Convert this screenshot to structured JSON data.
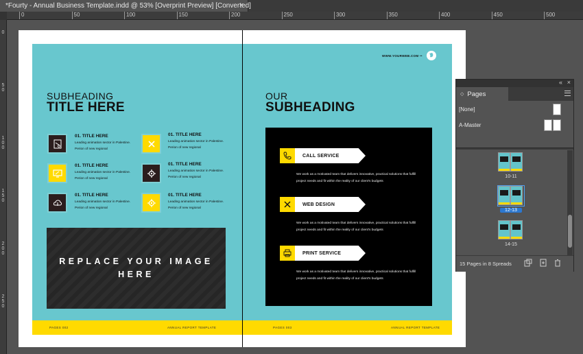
{
  "document_tab": {
    "title": "*Fourty - Annual Business Template.indd @ 53% [Overprint Preview] [Converted]",
    "close": "×"
  },
  "ruler_h": [
    "0",
    "50",
    "100",
    "150",
    "200",
    "250",
    "300",
    "350",
    "400",
    "450",
    "500"
  ],
  "ruler_v": [
    {
      "t": "0"
    },
    {
      "t": "5 0"
    },
    {
      "t": "1 0 0"
    },
    {
      "t": "1 5 0"
    },
    {
      "t": "2 0 0"
    },
    {
      "t": "2 5 0"
    }
  ],
  "left_page": {
    "subheading": "SUBHEADING",
    "title": "TITLE HERE",
    "features": [
      {
        "title": "01. TITLE HERE",
        "text": "Leading animation sector in Palestine. Perion of new regional",
        "icon": "note-icon"
      },
      {
        "title": "01. TITLE HERE",
        "text": "Leading animation sector in Palestine. Perion of new regional",
        "icon": "tools-icon"
      },
      {
        "title": "01. TITLE HERE",
        "text": "Leading animation sector in Palestine. Perion of new regional",
        "icon": "monitor-icon"
      },
      {
        "title": "01. TITLE HERE",
        "text": "Leading animation sector in Palestine. Perion of new regional",
        "icon": "gear-icon"
      },
      {
        "title": "01. TITLE HERE",
        "text": "Leading animation sector in Palestine. Perion of new regional",
        "icon": "cloud-icon"
      },
      {
        "title": "01. TITLE HERE",
        "text": "Leading animation sector in Palestine. Perion of new regional",
        "icon": "gear-icon"
      }
    ],
    "image_placeholder": "REPLACE YOUR IMAGE HERE",
    "footer_left": "PAGES 002",
    "footer_right": "ANNUAL REPORT TEMPLATE"
  },
  "right_page": {
    "web_url": "WWW.YOURWEB.COM ••",
    "subheading": "OUR",
    "title": "SUBHEADING",
    "services": [
      {
        "label": "CALL SERVICE",
        "text": "We work as a motivated team that delivers innovative, practical solutions that fulfill project needs and fit within the reality of our client's budgets",
        "icon": "phone-icon"
      },
      {
        "label": "WEB DESIGN",
        "text": "We work as a motivated team that delivers innovative, practical solutions that fulfill project needs and fit within the reality of our client's budgets",
        "icon": "tools-icon"
      },
      {
        "label": "PRINT SERVICE",
        "text": "We work as a motivated team that delivers innovative, practical solutions that fulfill project needs and fit within the reality of our client's budgets",
        "icon": "print-icon"
      }
    ],
    "footer_left": "PAGES 003",
    "footer_right": "ANNUAL REPORT TEMPLATE"
  },
  "pages_panel": {
    "tab_label": "Pages",
    "masters": [
      {
        "label": "[None]"
      },
      {
        "label": "A-Master"
      }
    ],
    "spreads": [
      {
        "label": "10-11",
        "selected": false
      },
      {
        "label": "12-13",
        "selected": true
      },
      {
        "label": "14-15",
        "selected": false
      }
    ],
    "status": "15 Pages in 8 Spreads"
  },
  "colors": {
    "page_teal": "#68c7ce",
    "accent_yellow": "#ffda00",
    "selection_blue": "#2c78d1"
  }
}
